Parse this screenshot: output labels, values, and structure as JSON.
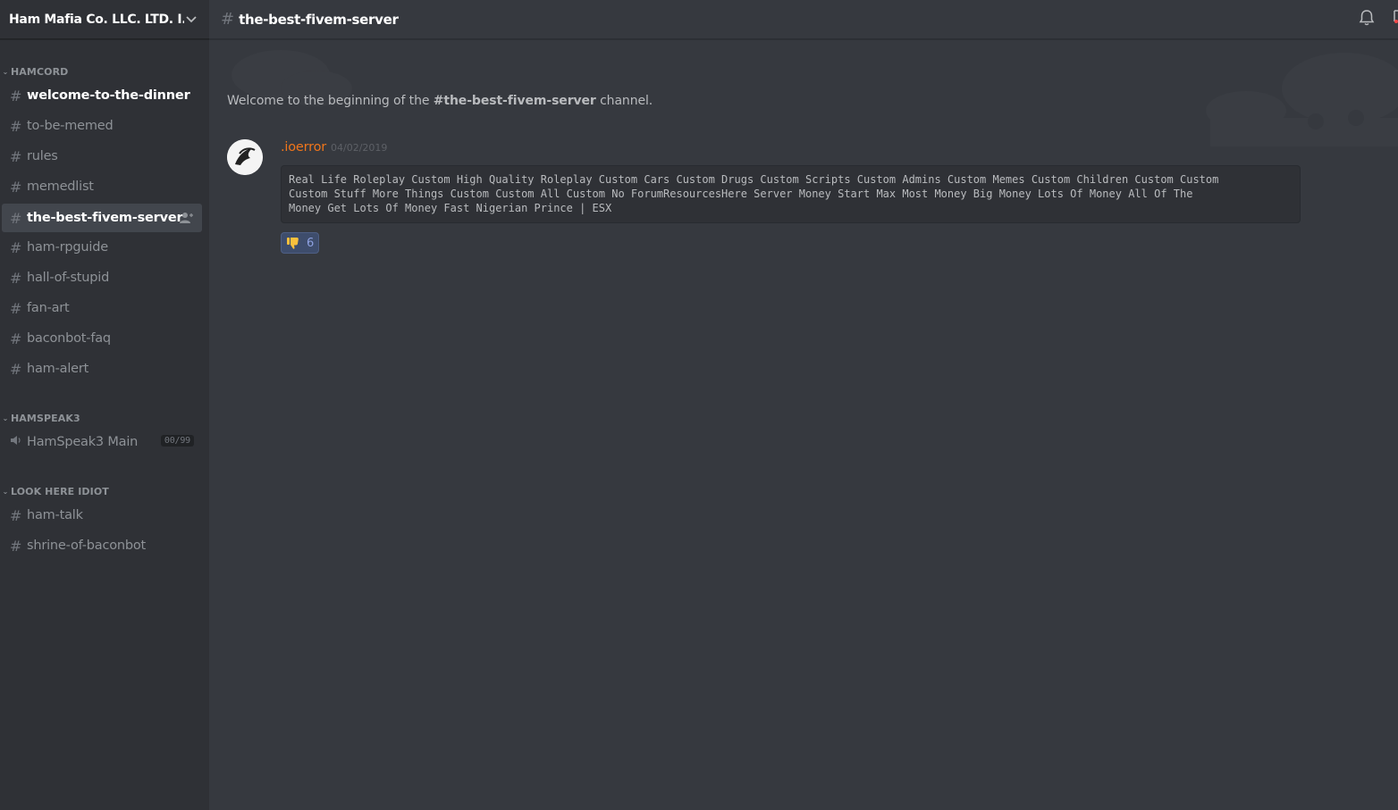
{
  "server": {
    "name": "Ham Mafia Co. LLC. LTD. I...",
    "categories": [
      {
        "name": "HAMCORD",
        "channels": [
          {
            "name": "welcome-to-the-dinner",
            "state": "unread"
          },
          {
            "name": "to-be-memed",
            "state": "normal"
          },
          {
            "name": "rules",
            "state": "normal"
          },
          {
            "name": "memedlist",
            "state": "normal"
          },
          {
            "name": "the-best-fivem-server",
            "state": "selected"
          },
          {
            "name": "ham-rpguide",
            "state": "normal"
          },
          {
            "name": "hall-of-stupid",
            "state": "normal"
          },
          {
            "name": "fan-art",
            "state": "normal"
          },
          {
            "name": "baconbot-faq",
            "state": "normal"
          },
          {
            "name": "ham-alert",
            "state": "normal"
          }
        ]
      },
      {
        "name": "HAMSPEAK3",
        "voice_channels": [
          {
            "name": "HamSpeak3 Main",
            "badge": "00/99"
          }
        ]
      },
      {
        "name": "LOOK HERE IDIOT",
        "channels": [
          {
            "name": "ham-talk",
            "state": "normal"
          },
          {
            "name": "shrine-of-baconbot",
            "state": "normal"
          }
        ]
      }
    ]
  },
  "topbar": {
    "channel_name": "the-best-fivem-server",
    "icons": [
      "bell-icon",
      "pin-icon"
    ]
  },
  "chat": {
    "welcome_prefix": "Welcome to the beginning of the ",
    "welcome_channel": "#the-best-fivem-server",
    "welcome_suffix": " channel.",
    "message": {
      "username": ".ioerror",
      "timestamp": "04/02/2019",
      "code": "Real Life Roleplay Custom High Quality Roleplay Custom Cars Custom Drugs Custom Scripts Custom Admins Custom Memes Custom Children Custom Custom\nCustom Stuff More Things Custom Custom All Custom No ForumResourcesHere Server Money Start Max Most Money Big Money Lots Of Money All Of The\nMoney Get Lots Of Money Fast Nigerian Prince | ESX",
      "reaction": {
        "emoji": "thumbs-down",
        "count": "6"
      }
    }
  },
  "colors": {
    "background": "#36393f",
    "sidebar": "#2f3136",
    "username": "#f0751b",
    "reaction_bg": "#3e4d6c",
    "reaction_text": "#8ea1e1"
  }
}
